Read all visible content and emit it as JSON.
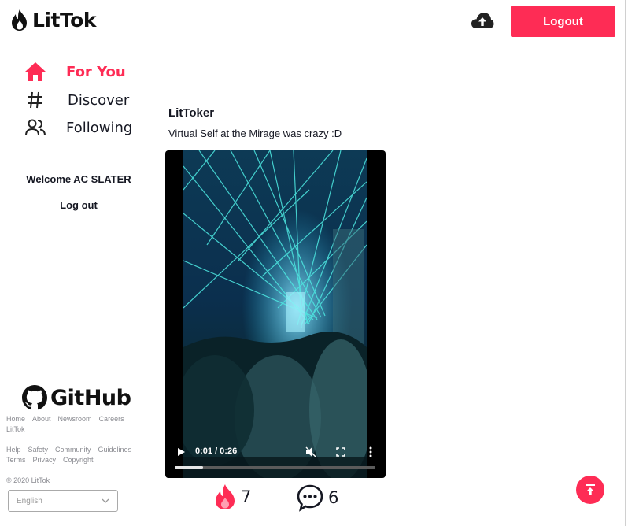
{
  "header": {
    "logo_text": "LitTok",
    "logout_label": "Logout"
  },
  "sidebar": {
    "items": [
      {
        "label": "For You",
        "icon": "home-icon",
        "active": true
      },
      {
        "label": "Discover",
        "icon": "hashtag-icon",
        "active": false
      },
      {
        "label": "Following",
        "icon": "users-icon",
        "active": false
      }
    ],
    "welcome": "Welcome AC SLATER",
    "logout_label": "Log out",
    "github_text": "GitHub"
  },
  "footer": {
    "row1": [
      "Home",
      "About",
      "Newsroom",
      "Careers"
    ],
    "row1b": [
      "LitTok"
    ],
    "row2": [
      "Help",
      "Safety",
      "Community",
      "Guidelines"
    ],
    "row3": [
      "Terms",
      "Privacy",
      "Copyright"
    ],
    "copyright": "© 2020 LitTok",
    "language": "English"
  },
  "post": {
    "username": "LitToker",
    "caption": "Virtual Self at the Mirage was crazy :D",
    "video_time": "0:01 / 0:26",
    "progress_fraction": 0.14,
    "likes": "7",
    "comments": "6"
  },
  "colors": {
    "accent": "#fe2c55",
    "text": "#161823",
    "muted": "#8a8b91"
  }
}
